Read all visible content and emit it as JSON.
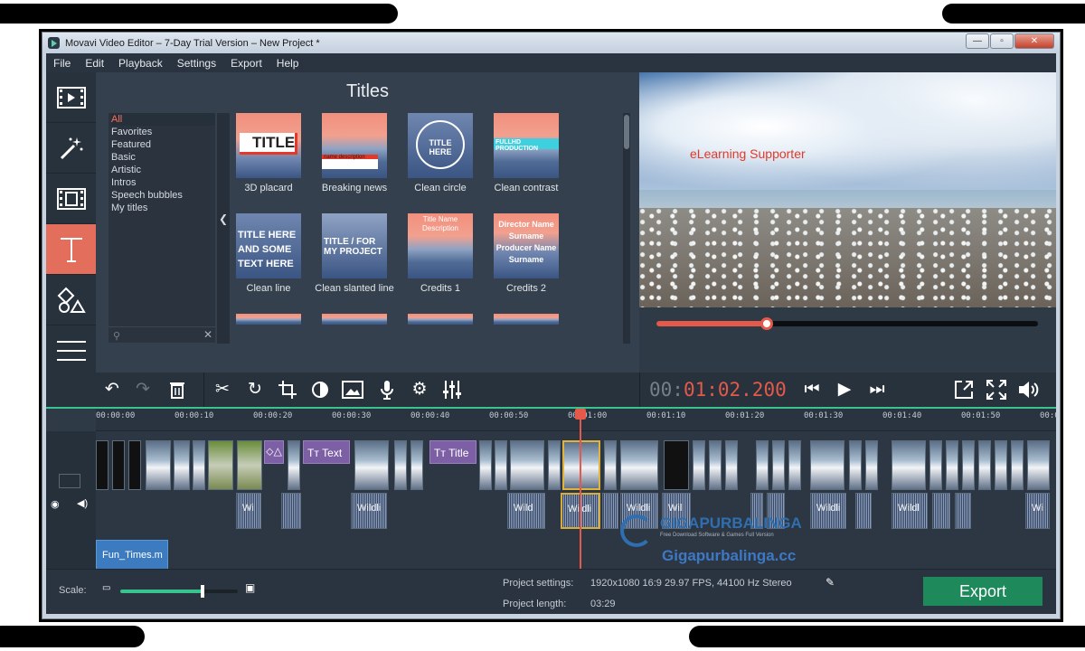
{
  "window": {
    "title": "Movavi Video Editor – 7-Day Trial Version – New Project *"
  },
  "menu": [
    "File",
    "Edit",
    "Playback",
    "Settings",
    "Export",
    "Help"
  ],
  "sidebar": {
    "items": [
      {
        "name": "import-media",
        "icon": "film-icon"
      },
      {
        "name": "filters",
        "icon": "magic-wand-icon"
      },
      {
        "name": "transitions",
        "icon": "transition-icon"
      },
      {
        "name": "titles",
        "icon": "text-t-icon",
        "active": true
      },
      {
        "name": "stickers",
        "icon": "shapes-icon"
      },
      {
        "name": "more",
        "icon": "list-icon"
      }
    ]
  },
  "browser": {
    "title": "Titles",
    "categories": [
      "All",
      "Favorites",
      "Featured",
      "Basic",
      "Artistic",
      "Intros",
      "Speech bubbles",
      "My titles"
    ],
    "selected_category": "All",
    "items": [
      {
        "label": "3D placard",
        "thumb_text": "TITLE"
      },
      {
        "label": "Breaking news",
        "thumb_text": "name description"
      },
      {
        "label": "Clean circle",
        "thumb_text": "TITLE HERE"
      },
      {
        "label": "Clean contrast",
        "thumb_text": "FULLHD PRODUCTION"
      },
      {
        "label": "Clean line",
        "thumb_text": "TITLE HERE AND SOME TEXT HERE"
      },
      {
        "label": "Clean slanted line",
        "thumb_text": "TITLE / FOR MY PROJECT"
      },
      {
        "label": "Credits 1",
        "thumb_text": "Title Name Description"
      },
      {
        "label": "Credits 2",
        "thumb_text": "Director Name Surname Producer Name Surname"
      }
    ]
  },
  "preview": {
    "overlay_text": "eLearning Supporter",
    "progress_fraction": 0.29,
    "timecode_dim": "00:",
    "timecode_main": "01:02.200"
  },
  "timeline": {
    "ruler": [
      "00:00:00",
      "00:00:10",
      "00:00:20",
      "00:00:30",
      "00:00:40",
      "00:00:50",
      "00:01:00",
      "00:01:10",
      "00:01:20",
      "00:01:30",
      "00:01:40",
      "00:01:50",
      "00:0"
    ],
    "title_clips": [
      "Text",
      "Title"
    ],
    "audio_labels": [
      "Wi",
      "Wildli",
      "Wild",
      "Wildli",
      "Wildli",
      "Wil",
      "Wildli",
      "Wildl",
      "Wi"
    ],
    "music_clip": "Fun_Times.m"
  },
  "bottom": {
    "scale_label": "Scale:",
    "scale_fraction": 0.7,
    "project_settings_label": "Project settings:",
    "project_settings_value": "1920x1080 16:9 29.97 FPS, 44100 Hz Stereo",
    "project_length_label": "Project length:",
    "project_length_value": "03:29",
    "export_label": "Export"
  },
  "watermark": {
    "name": "GIGAPURBALINGA",
    "tagline": "Free Download Software & Games Full Version",
    "url": "Gigapurbalinga.cc"
  },
  "colors": {
    "accent": "#e4594a",
    "active_tab": "#e46e5c",
    "export": "#1e8a5c",
    "timeline_line": "#37c48f"
  }
}
